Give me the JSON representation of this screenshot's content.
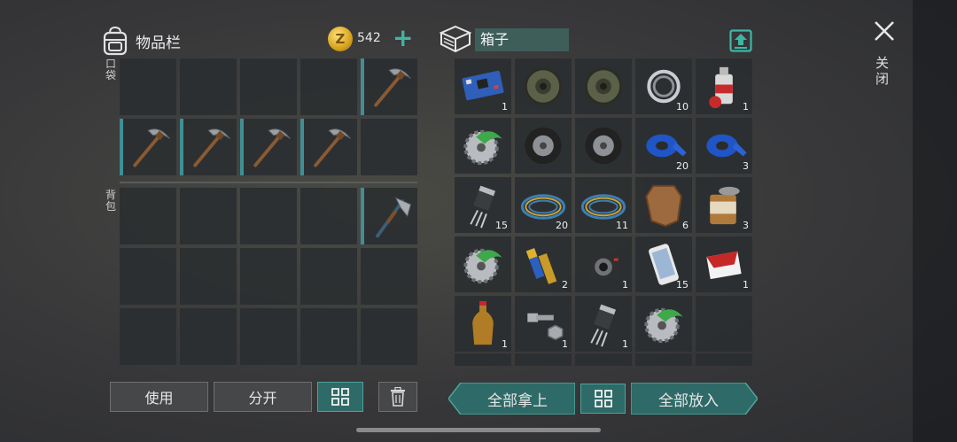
{
  "inventory": {
    "title": "物品栏",
    "coins": "542",
    "add_label": "+",
    "pocket_label": "口袋",
    "backpack_label": "背包"
  },
  "pocket": [
    {
      "item": "empty"
    },
    {
      "item": "empty"
    },
    {
      "item": "empty"
    },
    {
      "item": "empty"
    },
    {
      "item": "pickaxe-icon",
      "equipped": true
    },
    {
      "item": "pickaxe-icon",
      "equipped": true
    },
    {
      "item": "pickaxe-icon",
      "equipped": true
    },
    {
      "item": "pickaxe-icon",
      "equipped": true
    },
    {
      "item": "pickaxe-icon",
      "equipped": true
    },
    {
      "item": "empty"
    }
  ],
  "backpack": [
    {
      "item": "empty"
    },
    {
      "item": "empty"
    },
    {
      "item": "empty"
    },
    {
      "item": "empty"
    },
    {
      "item": "hatchet-icon",
      "equipped": true
    },
    {
      "item": "empty"
    },
    {
      "item": "empty"
    },
    {
      "item": "empty"
    },
    {
      "item": "empty"
    },
    {
      "item": "empty"
    },
    {
      "item": "empty"
    },
    {
      "item": "empty"
    },
    {
      "item": "empty"
    },
    {
      "item": "empty"
    },
    {
      "item": "empty"
    }
  ],
  "container": {
    "name": "箱子",
    "items": [
      {
        "item": "circuit-board-icon",
        "count": "1"
      },
      {
        "item": "brake-disc-icon",
        "count": ""
      },
      {
        "item": "brake-disc-icon",
        "count": ""
      },
      {
        "item": "bearing-ring-icon",
        "count": "10"
      },
      {
        "item": "spray-can-icon",
        "count": "1"
      },
      {
        "item": "saw-blade-icon",
        "count": ""
      },
      {
        "item": "tire-icon",
        "count": ""
      },
      {
        "item": "tire-icon",
        "count": ""
      },
      {
        "item": "duct-tape-icon",
        "count": "20"
      },
      {
        "item": "duct-tape-icon",
        "count": "3"
      },
      {
        "item": "transistor-icon",
        "count": "15"
      },
      {
        "item": "wire-coil-icon",
        "count": "20"
      },
      {
        "item": "wire-coil-icon",
        "count": "11"
      },
      {
        "item": "leather-hide-icon",
        "count": "6"
      },
      {
        "item": "tin-can-icon",
        "count": "3"
      },
      {
        "item": "saw-blade-icon",
        "count": ""
      },
      {
        "item": "batteries-icon",
        "count": "2"
      },
      {
        "item": "camera-icon",
        "count": "1"
      },
      {
        "item": "smartphone-icon",
        "count": "15"
      },
      {
        "item": "cigarette-pack-icon",
        "count": "1"
      },
      {
        "item": "bottle-icon",
        "count": "1"
      },
      {
        "item": "bolt-nut-icon",
        "count": "1"
      },
      {
        "item": "transistor-icon",
        "count": "1"
      },
      {
        "item": "saw-blade-icon",
        "count": ""
      },
      {
        "item": "empty",
        "count": ""
      }
    ]
  },
  "buttons": {
    "use": "使用",
    "split": "分开",
    "take_all": "全部拿上",
    "put_all": "全部放入"
  },
  "close_label": "关闭",
  "colors": {
    "accent": "#3fb6a4",
    "slot": "#2a2e30",
    "equipped_marker": "#3f8f95",
    "button_teal": "#2e6a67"
  }
}
